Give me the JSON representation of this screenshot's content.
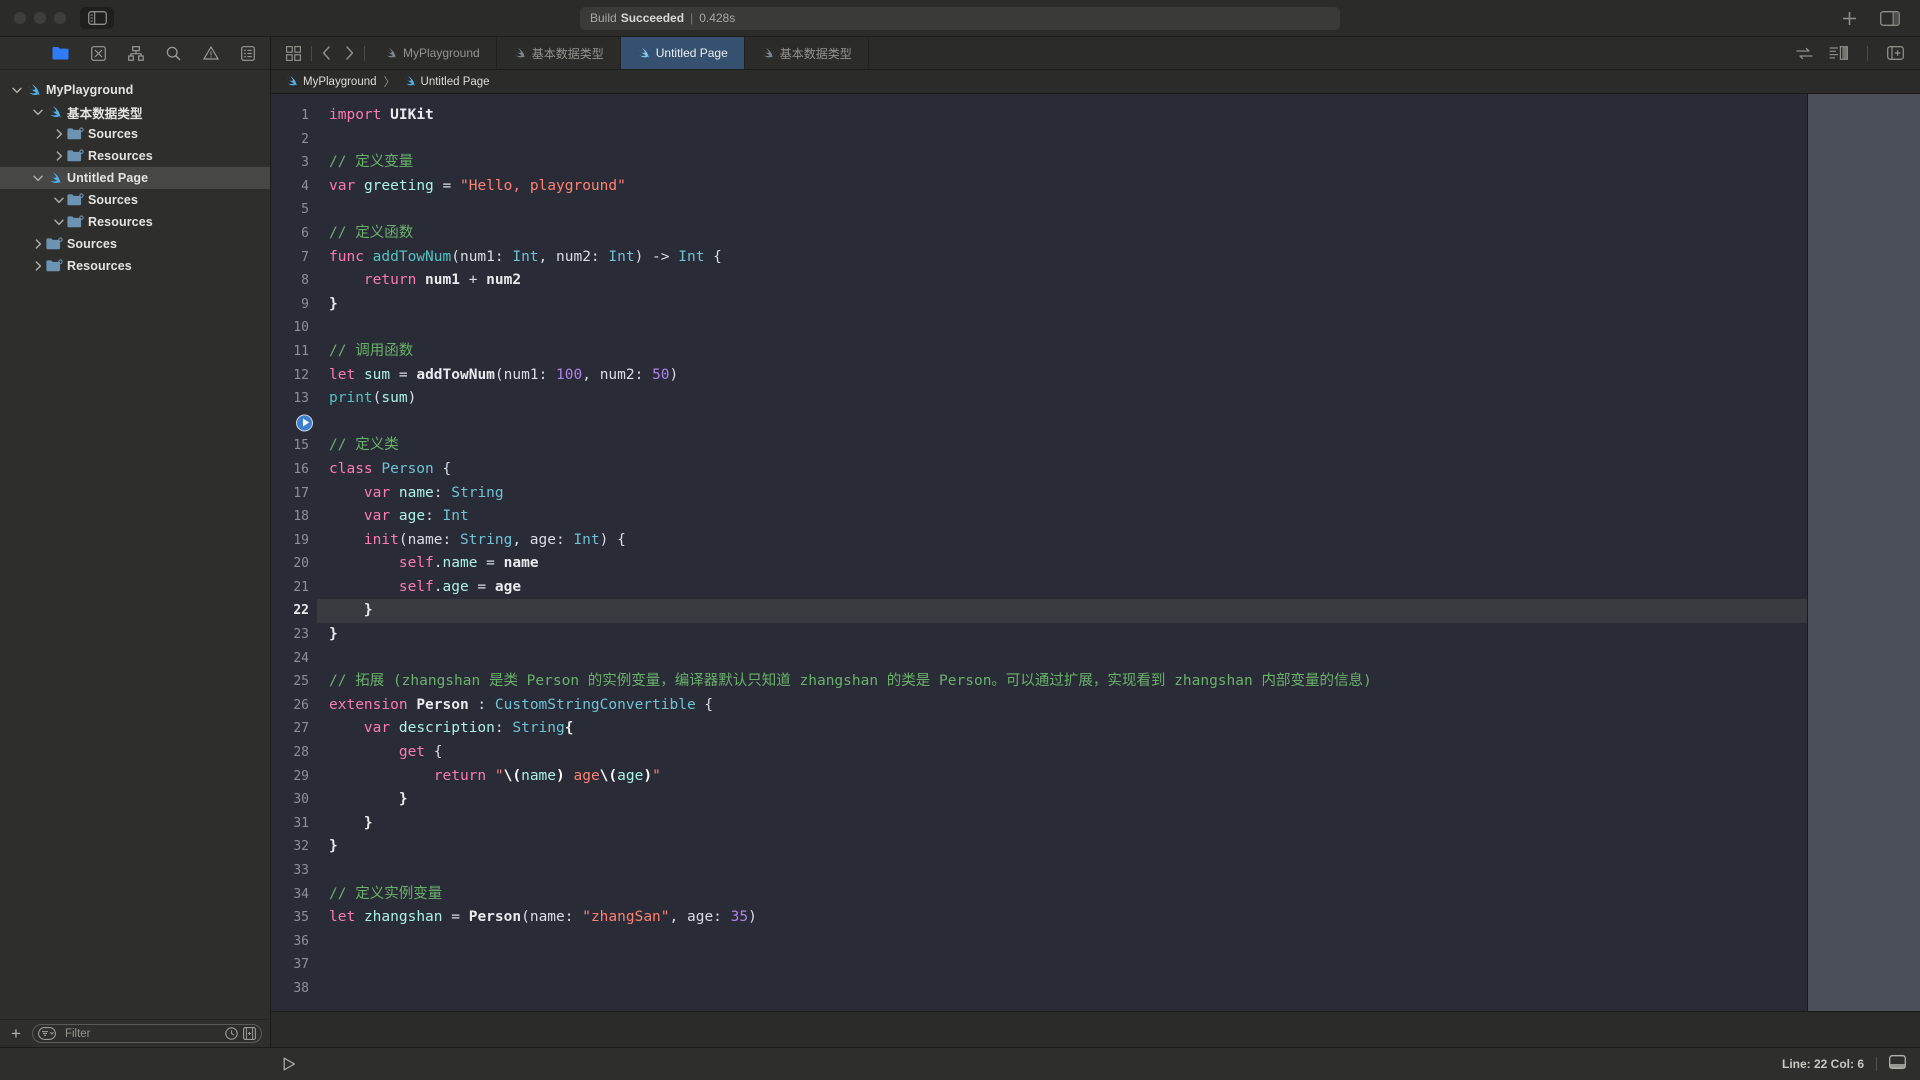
{
  "window": {
    "traffic_lights": [
      "close",
      "minimize",
      "zoom"
    ],
    "sidebar_toggle_icon": "sidebar-left-icon"
  },
  "build_status": {
    "label": "Build",
    "state": "Succeeded",
    "separator": "|",
    "time": "0.428s"
  },
  "title_toolbar": {
    "add_label": "+",
    "add_icon": "plus-icon",
    "inspector_icon": "right-panel-icon"
  },
  "navigator": {
    "toolbar_icons": [
      {
        "name": "folder-icon",
        "label": "Project navigator",
        "active": true
      },
      {
        "name": "source-control-icon",
        "label": "Source control navigator",
        "active": false
      },
      {
        "name": "hierarchy-icon",
        "label": "Symbol navigator",
        "active": false
      },
      {
        "name": "search-icon",
        "label": "Find navigator",
        "active": false
      },
      {
        "name": "warning-triangle-icon",
        "label": "Issue navigator",
        "active": false
      },
      {
        "name": "report-icon",
        "label": "Report navigator",
        "active": false
      }
    ],
    "tree": [
      {
        "label": "MyPlayground",
        "icon": "swift-playground-icon",
        "indent": 0,
        "twisty": "down",
        "selected": false
      },
      {
        "label": "基本数据类型",
        "icon": "swift-playground-icon",
        "indent": 1,
        "twisty": "down",
        "selected": false
      },
      {
        "label": "Sources",
        "icon": "folder-badge-icon",
        "indent": 2,
        "twisty": "right",
        "selected": false
      },
      {
        "label": "Resources",
        "icon": "folder-badge-icon",
        "indent": 2,
        "twisty": "right",
        "selected": false
      },
      {
        "label": "Untitled Page",
        "icon": "swift-playground-icon",
        "indent": 1,
        "twisty": "down",
        "selected": true
      },
      {
        "label": "Sources",
        "icon": "folder-badge-icon",
        "indent": 2,
        "twisty": "down",
        "selected": false
      },
      {
        "label": "Resources",
        "icon": "folder-badge-icon",
        "indent": 2,
        "twisty": "down",
        "selected": false
      },
      {
        "label": "Sources",
        "icon": "folder-badge-icon",
        "indent": 1,
        "twisty": "right",
        "selected": false
      },
      {
        "label": "Resources",
        "icon": "folder-badge-icon",
        "indent": 1,
        "twisty": "right",
        "selected": false
      }
    ],
    "filter": {
      "placeholder": "Filter",
      "add_button": "+",
      "scope_icon": "filter-scope-icon",
      "recent_icon": "clock-icon",
      "source-control_icon": "source-control-filter-icon"
    }
  },
  "tabbar": {
    "grid_icon": "tab-grid-icon",
    "back_icon": "chevron-left-icon",
    "forward_icon": "chevron-right-icon",
    "tabs": [
      {
        "label": "MyPlayground",
        "icon": "swift-icon",
        "active": false
      },
      {
        "label": "基本数据类型",
        "icon": "swift-icon",
        "active": false
      },
      {
        "label": "Untitled Page",
        "icon": "swift-icon",
        "active": true
      },
      {
        "label": "基本数据类型",
        "icon": "swift-icon",
        "active": false
      }
    ],
    "right_icons": [
      {
        "name": "assistant-editor-icon"
      },
      {
        "name": "code-review-icon"
      },
      {
        "name": "add-editor-icon"
      }
    ]
  },
  "breadcrumb": {
    "items": [
      {
        "label": "MyPlayground",
        "icon": "swift-icon"
      },
      {
        "label": "Untitled Page",
        "icon": "swift-icon"
      }
    ],
    "separator": "〉"
  },
  "editor": {
    "language": "Swift",
    "current_line": 22,
    "execution_marker_line": 14,
    "lines": [
      {
        "n": 1,
        "tokens": [
          {
            "t": "import",
            "c": "k"
          },
          {
            "t": " ",
            "c": "p"
          },
          {
            "t": "UIKit",
            "c": "bd"
          }
        ]
      },
      {
        "n": 2,
        "tokens": []
      },
      {
        "n": 3,
        "tokens": [
          {
            "t": "// 定义变量",
            "c": "c"
          }
        ]
      },
      {
        "n": 4,
        "tokens": [
          {
            "t": "var",
            "c": "k"
          },
          {
            "t": " ",
            "c": "p"
          },
          {
            "t": "greeting",
            "c": "v"
          },
          {
            "t": " = ",
            "c": "p"
          },
          {
            "t": "\"Hello, playground\"",
            "c": "s"
          }
        ]
      },
      {
        "n": 5,
        "tokens": []
      },
      {
        "n": 6,
        "tokens": [
          {
            "t": "// 定义函数",
            "c": "c"
          }
        ]
      },
      {
        "n": 7,
        "tokens": [
          {
            "t": "func",
            "c": "k"
          },
          {
            "t": " ",
            "c": "p"
          },
          {
            "t": "addTowNum",
            "c": "fn"
          },
          {
            "t": "(num1: ",
            "c": "p"
          },
          {
            "t": "Int",
            "c": "ty"
          },
          {
            "t": ", num2: ",
            "c": "p"
          },
          {
            "t": "Int",
            "c": "ty"
          },
          {
            "t": ") -> ",
            "c": "p"
          },
          {
            "t": "Int",
            "c": "ty"
          },
          {
            "t": " {",
            "c": "p"
          }
        ]
      },
      {
        "n": 8,
        "tokens": [
          {
            "t": "    ",
            "c": "p"
          },
          {
            "t": "return",
            "c": "k"
          },
          {
            "t": " ",
            "c": "p"
          },
          {
            "t": "num1",
            "c": "bd"
          },
          {
            "t": " + ",
            "c": "p"
          },
          {
            "t": "num2",
            "c": "bd"
          }
        ]
      },
      {
        "n": 9,
        "tokens": [
          {
            "t": "}",
            "c": "bd"
          }
        ]
      },
      {
        "n": 10,
        "tokens": []
      },
      {
        "n": 11,
        "tokens": [
          {
            "t": "// 调用函数",
            "c": "c"
          }
        ]
      },
      {
        "n": 12,
        "tokens": [
          {
            "t": "let",
            "c": "k"
          },
          {
            "t": " ",
            "c": "p"
          },
          {
            "t": "sum",
            "c": "v"
          },
          {
            "t": " = ",
            "c": "p"
          },
          {
            "t": "addTowNum",
            "c": "bd"
          },
          {
            "t": "(num1: ",
            "c": "p"
          },
          {
            "t": "100",
            "c": "n"
          },
          {
            "t": ", num2: ",
            "c": "p"
          },
          {
            "t": "50",
            "c": "n"
          },
          {
            "t": ")",
            "c": "p"
          }
        ]
      },
      {
        "n": 13,
        "tokens": [
          {
            "t": "print",
            "c": "fn"
          },
          {
            "t": "(",
            "c": "p"
          },
          {
            "t": "sum",
            "c": "v"
          },
          {
            "t": ")",
            "c": "p"
          }
        ]
      },
      {
        "n": 14,
        "tokens": []
      },
      {
        "n": 15,
        "tokens": [
          {
            "t": "// 定义类",
            "c": "c"
          }
        ]
      },
      {
        "n": 16,
        "tokens": [
          {
            "t": "class",
            "c": "k"
          },
          {
            "t": " ",
            "c": "p"
          },
          {
            "t": "Person",
            "c": "ty"
          },
          {
            "t": " {",
            "c": "p"
          }
        ]
      },
      {
        "n": 17,
        "tokens": [
          {
            "t": "    ",
            "c": "p"
          },
          {
            "t": "var",
            "c": "k"
          },
          {
            "t": " ",
            "c": "p"
          },
          {
            "t": "name",
            "c": "v"
          },
          {
            "t": ": ",
            "c": "p"
          },
          {
            "t": "String",
            "c": "ty"
          }
        ]
      },
      {
        "n": 18,
        "tokens": [
          {
            "t": "    ",
            "c": "p"
          },
          {
            "t": "var",
            "c": "k"
          },
          {
            "t": " ",
            "c": "p"
          },
          {
            "t": "age",
            "c": "v"
          },
          {
            "t": ": ",
            "c": "p"
          },
          {
            "t": "Int",
            "c": "ty"
          }
        ]
      },
      {
        "n": 19,
        "tokens": [
          {
            "t": "    ",
            "c": "p"
          },
          {
            "t": "init",
            "c": "k"
          },
          {
            "t": "(name: ",
            "c": "p"
          },
          {
            "t": "String",
            "c": "ty"
          },
          {
            "t": ", age: ",
            "c": "p"
          },
          {
            "t": "Int",
            "c": "ty"
          },
          {
            "t": ") {",
            "c": "p"
          }
        ]
      },
      {
        "n": 20,
        "tokens": [
          {
            "t": "        ",
            "c": "p"
          },
          {
            "t": "self",
            "c": "k"
          },
          {
            "t": ".",
            "c": "p"
          },
          {
            "t": "name",
            "c": "v"
          },
          {
            "t": " = ",
            "c": "p"
          },
          {
            "t": "name",
            "c": "bd"
          }
        ]
      },
      {
        "n": 21,
        "tokens": [
          {
            "t": "        ",
            "c": "p"
          },
          {
            "t": "self",
            "c": "k"
          },
          {
            "t": ".",
            "c": "p"
          },
          {
            "t": "age",
            "c": "v"
          },
          {
            "t": " = ",
            "c": "p"
          },
          {
            "t": "age",
            "c": "bd"
          }
        ]
      },
      {
        "n": 22,
        "tokens": [
          {
            "t": "    }",
            "c": "bd"
          }
        ]
      },
      {
        "n": 23,
        "tokens": [
          {
            "t": "}",
            "c": "bd"
          }
        ]
      },
      {
        "n": 24,
        "tokens": []
      },
      {
        "n": 25,
        "tokens": [
          {
            "t": "// 拓展 (zhangshan 是类 Person 的实例变量，编译器默认只知道 zhangshan 的类是 Person。可以通过扩展，实现看到 zhangshan 内部变量的信息)",
            "c": "c"
          }
        ]
      },
      {
        "n": 26,
        "tokens": [
          {
            "t": "extension",
            "c": "k"
          },
          {
            "t": " ",
            "c": "p"
          },
          {
            "t": "Person",
            "c": "bd"
          },
          {
            "t": " : ",
            "c": "p"
          },
          {
            "t": "CustomStringConvertible",
            "c": "ty"
          },
          {
            "t": " {",
            "c": "p"
          }
        ]
      },
      {
        "n": 27,
        "tokens": [
          {
            "t": "    ",
            "c": "p"
          },
          {
            "t": "var",
            "c": "k"
          },
          {
            "t": " ",
            "c": "p"
          },
          {
            "t": "description",
            "c": "v"
          },
          {
            "t": ": ",
            "c": "p"
          },
          {
            "t": "String",
            "c": "ty"
          },
          {
            "t": "{",
            "c": "bd"
          }
        ]
      },
      {
        "n": 28,
        "tokens": [
          {
            "t": "        ",
            "c": "p"
          },
          {
            "t": "get",
            "c": "k"
          },
          {
            "t": " {",
            "c": "p"
          }
        ]
      },
      {
        "n": 29,
        "tokens": [
          {
            "t": "            ",
            "c": "p"
          },
          {
            "t": "return",
            "c": "k"
          },
          {
            "t": " ",
            "c": "p"
          },
          {
            "t": "\"",
            "c": "s"
          },
          {
            "t": "\\(",
            "c": "esc"
          },
          {
            "t": "name",
            "c": "v"
          },
          {
            "t": ")",
            "c": "esc"
          },
          {
            "t": " age",
            "c": "s"
          },
          {
            "t": "\\(",
            "c": "esc"
          },
          {
            "t": "age",
            "c": "v"
          },
          {
            "t": ")",
            "c": "esc"
          },
          {
            "t": "\"",
            "c": "s"
          }
        ]
      },
      {
        "n": 30,
        "tokens": [
          {
            "t": "        }",
            "c": "bd"
          }
        ]
      },
      {
        "n": 31,
        "tokens": [
          {
            "t": "    }",
            "c": "bd"
          }
        ]
      },
      {
        "n": 32,
        "tokens": [
          {
            "t": "}",
            "c": "bd"
          }
        ]
      },
      {
        "n": 33,
        "tokens": []
      },
      {
        "n": 34,
        "tokens": [
          {
            "t": "// 定义实例变量",
            "c": "c"
          }
        ]
      },
      {
        "n": 35,
        "tokens": [
          {
            "t": "let",
            "c": "k"
          },
          {
            "t": " ",
            "c": "p"
          },
          {
            "t": "zhangshan",
            "c": "v"
          },
          {
            "t": " = ",
            "c": "p"
          },
          {
            "t": "Person",
            "c": "bd"
          },
          {
            "t": "(name: ",
            "c": "p"
          },
          {
            "t": "\"zhangSan\"",
            "c": "s"
          },
          {
            "t": ", age: ",
            "c": "p"
          },
          {
            "t": "35",
            "c": "n"
          },
          {
            "t": ")",
            "c": "p"
          }
        ]
      },
      {
        "n": 36,
        "tokens": []
      },
      {
        "n": 37,
        "tokens": []
      },
      {
        "n": 38,
        "tokens": []
      }
    ]
  },
  "statusbar": {
    "run_icon": "play-triangle-icon",
    "line_label": "Line:",
    "line_value": "22",
    "col_label": "Col:",
    "col_value": "6",
    "position_text": "Line: 22  Col: 6",
    "debug_area_icon": "debug-area-icon"
  },
  "colors": {
    "accent_blue": "#2f7cf6",
    "tab_active_bg": "#36506f",
    "editor_bg": "#292c36",
    "chrome_bg": "#2e2e2c",
    "swift_icon": "#4fb0e8",
    "folder_icon": "#6d93b3",
    "comment_green": "#69b06a",
    "string_red": "#ff8170",
    "keyword_pink": "#ff7ab2",
    "type_cyan": "#6fc2d6",
    "number_purple": "#b281eb"
  }
}
